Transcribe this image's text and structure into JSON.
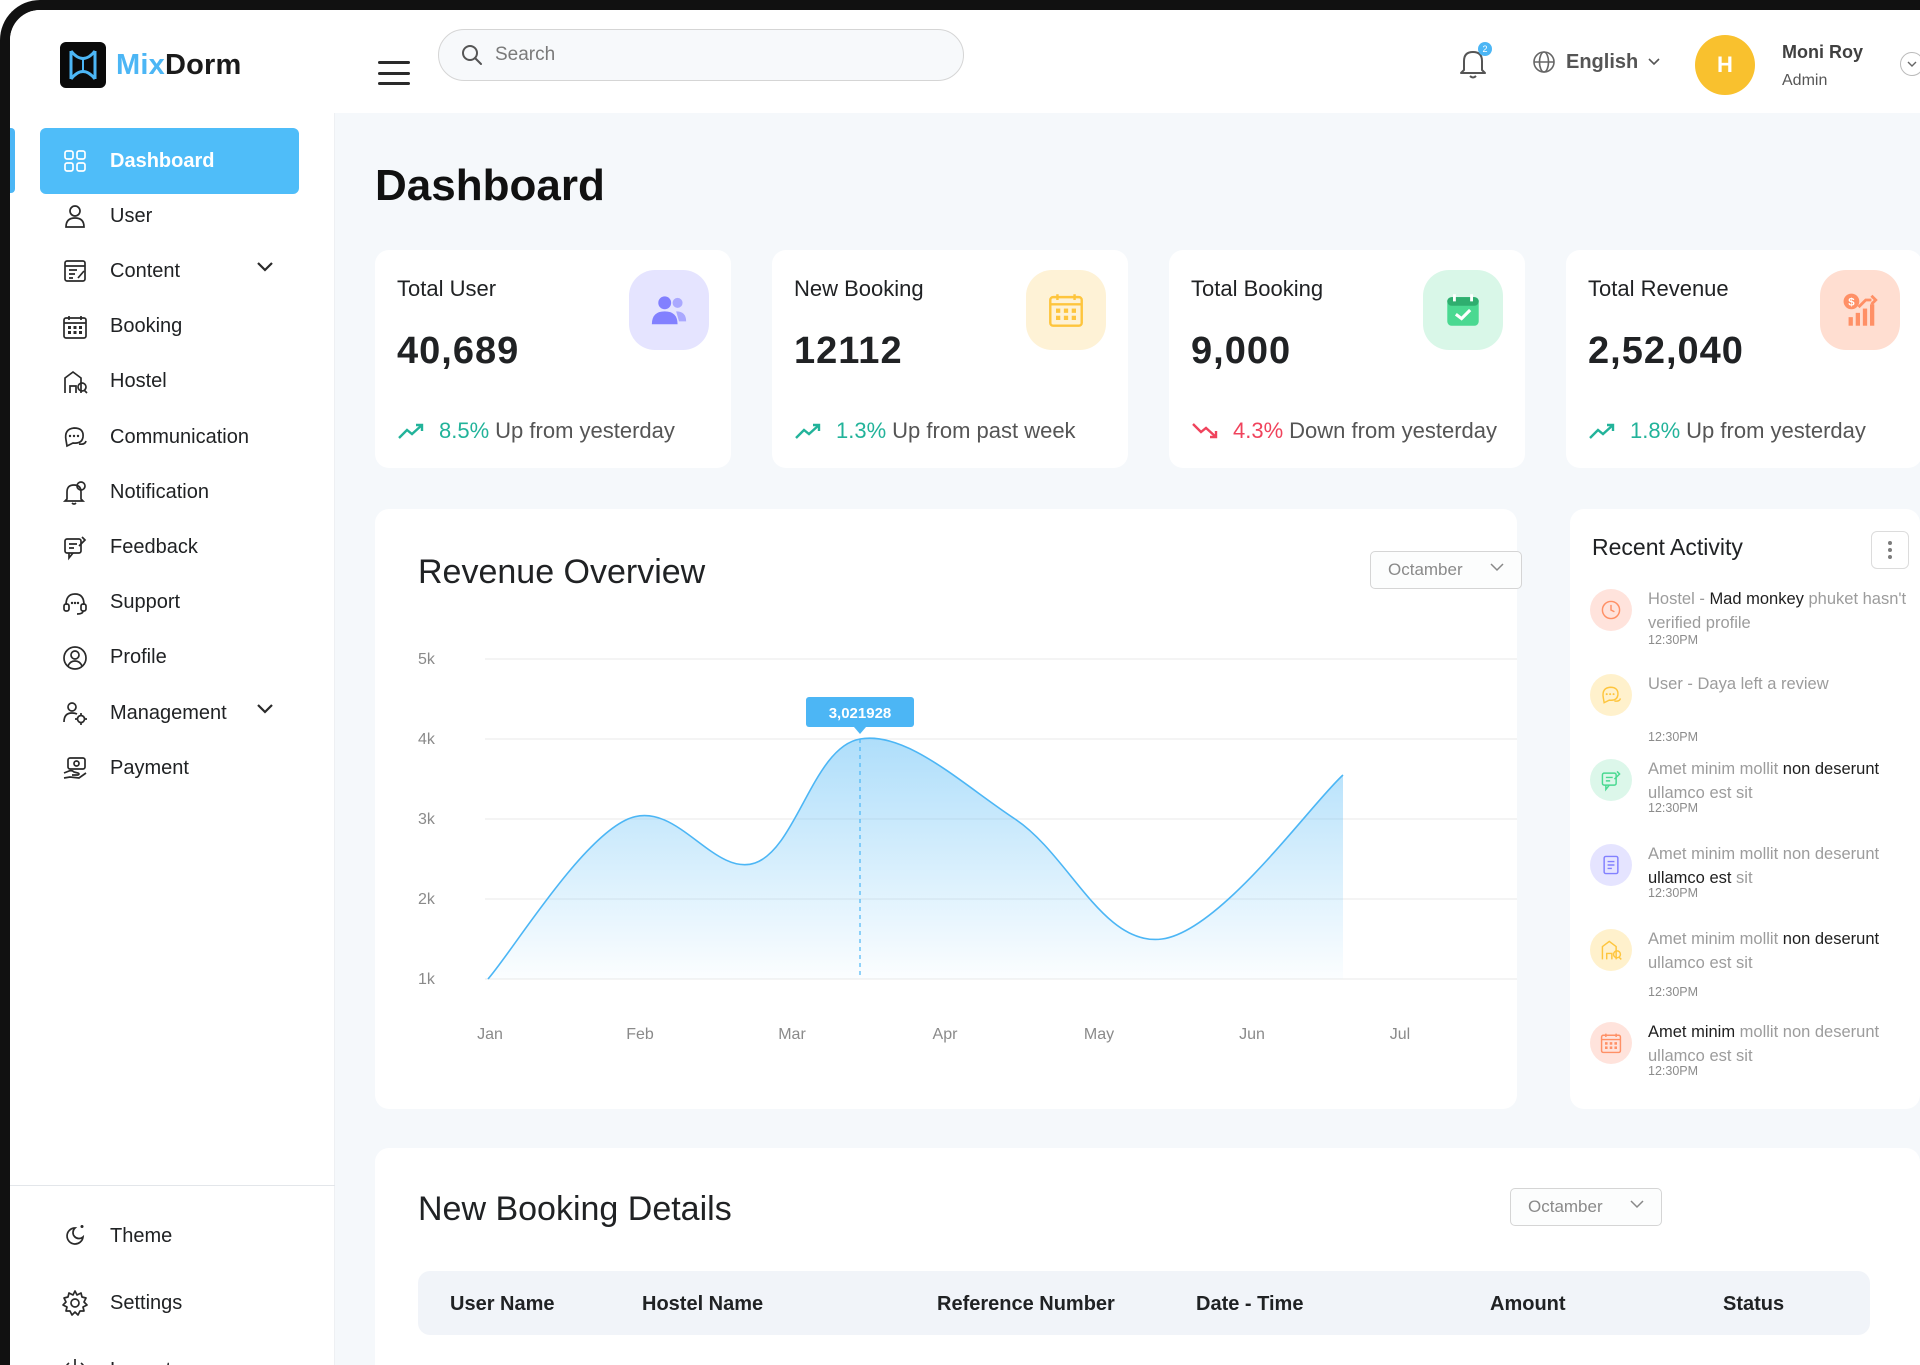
{
  "app": {
    "name_prefix": "Mix",
    "name_suffix": "Dorm"
  },
  "header": {
    "search_placeholder": "Search",
    "notification_count": "2",
    "language": "English",
    "user": {
      "initial": "H",
      "name": "Moni Roy",
      "role": "Admin"
    }
  },
  "sidebar": {
    "items": [
      {
        "label": "Dashboard",
        "icon": "grid-icon",
        "active": true
      },
      {
        "label": "User",
        "icon": "user-icon"
      },
      {
        "label": "Content",
        "icon": "content-icon",
        "expandable": true
      },
      {
        "label": "Booking",
        "icon": "calendar-icon"
      },
      {
        "label": "Hostel",
        "icon": "hostel-icon"
      },
      {
        "label": "Communication",
        "icon": "chat-icon"
      },
      {
        "label": "Notification",
        "icon": "bell-icon"
      },
      {
        "label": "Feedback",
        "icon": "feedback-icon"
      },
      {
        "label": "Support",
        "icon": "headset-icon"
      },
      {
        "label": "Profile",
        "icon": "profile-icon"
      },
      {
        "label": "Management",
        "icon": "management-icon",
        "expandable": true
      },
      {
        "label": "Payment",
        "icon": "payment-icon"
      }
    ],
    "bottom": [
      {
        "label": "Theme",
        "icon": "theme-icon"
      },
      {
        "label": "Settings",
        "icon": "gear-icon"
      },
      {
        "label": "Logout",
        "icon": "logout-icon"
      }
    ]
  },
  "main": {
    "title": "Dashboard",
    "stats": [
      {
        "title": "Total User",
        "value": "40,689",
        "pct": "8.5%",
        "trend_text": "Up from yesterday",
        "direction": "up",
        "icon": "users-icon",
        "icon_bg": "#e5e4ff",
        "icon_color": "#8280ff"
      },
      {
        "title": "New Booking",
        "value": "12112",
        "pct": "1.3%",
        "trend_text": "Up from past week",
        "direction": "up",
        "icon": "calendar-icon",
        "icon_bg": "#fef2d6",
        "icon_color": "#fec53d"
      },
      {
        "title": "Total Booking",
        "value": "9,000",
        "pct": "4.3%",
        "trend_text": "Down from yesterday",
        "direction": "down",
        "icon": "calendar-check-icon",
        "icon_bg": "#d9f7e8",
        "icon_color": "#4ad991"
      },
      {
        "title": "Total Revenue",
        "value": "2,52,040",
        "pct": "1.8%",
        "trend_text": "Up from yesterday",
        "direction": "up",
        "icon": "revenue-icon",
        "icon_bg": "#ffded1",
        "icon_color": "#ff9066"
      }
    ],
    "revenue": {
      "title": "Revenue Overview",
      "period": "Octamber"
    },
    "activity": {
      "title": "Recent Activity",
      "items": [
        {
          "icon": "clock-icon",
          "bg": "#ffe3dc",
          "color": "#ff9066",
          "parts": [
            {
              "t": "Hostel - ",
              "dark": false
            },
            {
              "t": "Mad monkey",
              "dark": true
            },
            {
              "t": " phuket hasn't verified profile",
              "dark": false
            }
          ],
          "time": "12:30PM"
        },
        {
          "icon": "chat-icon",
          "bg": "#fff1cc",
          "color": "#fec53d",
          "parts": [
            {
              "t": "User - Daya left a review",
              "dark": false
            }
          ],
          "time": "12:30PM"
        },
        {
          "icon": "feedback-icon",
          "bg": "#dcf7ea",
          "color": "#4ad991",
          "parts": [
            {
              "t": "Amet minim mollit ",
              "dark": false
            },
            {
              "t": "non deserunt",
              "dark": true
            },
            {
              "t": " ullamco est sit",
              "dark": false
            }
          ],
          "time": "12:30PM"
        },
        {
          "icon": "document-icon",
          "bg": "#e5e4ff",
          "color": "#8280ff",
          "parts": [
            {
              "t": "Amet minim mollit non deserunt ",
              "dark": false
            },
            {
              "t": "ullamco est",
              "dark": true
            },
            {
              "t": " sit",
              "dark": false
            }
          ],
          "time": "12:30PM"
        },
        {
          "icon": "hostel-icon",
          "bg": "#fff1cc",
          "color": "#fec53d",
          "parts": [
            {
              "t": "Amet minim mollit ",
              "dark": false
            },
            {
              "t": "non deserunt",
              "dark": true
            },
            {
              "t": " ullamco est sit",
              "dark": false
            }
          ],
          "time": "12:30PM"
        },
        {
          "icon": "calendar-icon",
          "bg": "#ffe3dc",
          "color": "#ff9066",
          "parts": [
            {
              "t": "Amet minim",
              "dark": true
            },
            {
              "t": " mollit non deserunt ullamco est sit",
              "dark": false
            }
          ],
          "time": "12:30PM"
        }
      ]
    },
    "booking": {
      "title": "New Booking Details",
      "period": "Octamber",
      "columns": [
        "User Name",
        "Hostel Name",
        "Reference Number",
        "Date - Time",
        "Amount",
        "Status"
      ]
    }
  },
  "colors": {
    "accent": "#4fbdf9",
    "up": "#22b39a",
    "down": "#f0435c"
  },
  "chart_data": {
    "type": "area",
    "categories": [
      "Jan",
      "Feb",
      "Mar",
      "Apr",
      "May",
      "Jun",
      "Jul"
    ],
    "yticks": [
      "5k",
      "4k",
      "3k",
      "2k",
      "1k"
    ],
    "ylim": [
      1000,
      5000
    ],
    "points": [
      {
        "x": "Jan",
        "y": 1000
      },
      {
        "x": "Feb",
        "y": 3000
      },
      {
        "x": "Mar",
        "y": 2450
      },
      {
        "x": "Apr",
        "y": 4000
      },
      {
        "x": "May",
        "y": 3000
      },
      {
        "x": "May-Jun",
        "y": 1500
      },
      {
        "x": "Jul",
        "y": 3550
      }
    ],
    "highlight": {
      "x": "Apr",
      "y": 4000,
      "label": "3,021928"
    },
    "grid": true,
    "color": "#4cb6f5"
  }
}
